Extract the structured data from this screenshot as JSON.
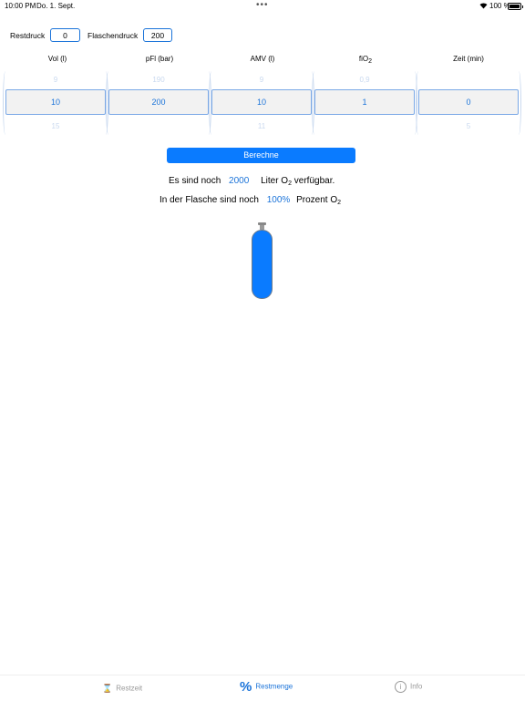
{
  "status": {
    "time": "10:00 PM",
    "date": "Do. 1. Sept.",
    "battery": "100 %"
  },
  "inputs": {
    "restdruck_label": "Restdruck",
    "restdruck_value": "0",
    "flaschendruck_label": "Flaschendruck",
    "flaschendruck_value": "200"
  },
  "columns": [
    {
      "header": "Vol (l)",
      "above": "9",
      "selected": "10",
      "below": "15"
    },
    {
      "header": "pFl (bar)",
      "above": "190",
      "selected": "200",
      "below": ""
    },
    {
      "header": "AMV (l)",
      "above": "9",
      "selected": "10",
      "below": "11"
    },
    {
      "header": "fiO",
      "header_sub": "2",
      "above": "0,9",
      "selected": "1",
      "below": ""
    },
    {
      "header": "Zeit (min)",
      "above": "",
      "selected": "0",
      "below": "5"
    }
  ],
  "button": {
    "label": "Berechne"
  },
  "result": {
    "line1_prefix": "Es sind noch",
    "liters": "2000",
    "line1_suffix_a": "Liter O",
    "line1_sub": "2",
    "line1_suffix_b": " verfügbar.",
    "line2_prefix": "In der Flasche sind noch",
    "percent": "100%",
    "line2_suffix_a": "Prozent O",
    "line2_sub": "2"
  },
  "cylinder": {
    "fill_fraction": 1.0,
    "color": "#0a7bff"
  },
  "tabs": [
    {
      "label": "Restzeit",
      "icon": "hourglass-icon"
    },
    {
      "label": "Restmenge",
      "icon": "percent-icon",
      "active": true
    },
    {
      "label": "Info",
      "icon": "info-icon"
    }
  ],
  "colors": {
    "accent": "#0a7bff"
  }
}
